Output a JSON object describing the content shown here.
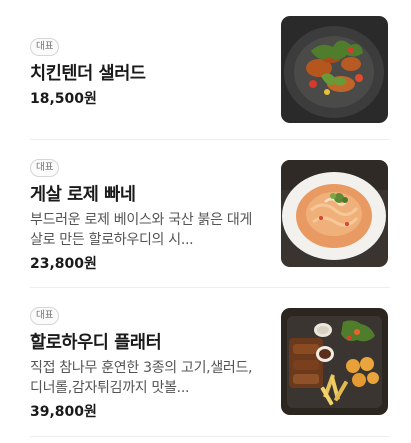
{
  "menu": {
    "items": [
      {
        "badge": "대표",
        "name": "치킨텐더 샐러드",
        "description": "",
        "price": "18,500원",
        "photo_icon": "chicken-tender-salad-photo"
      },
      {
        "badge": "대표",
        "name": "게살 로제 빠네",
        "description": "부드러운 로제 베이스와 국산 붉은 대게살로 만든 할로하우디의 시...",
        "price": "23,800원",
        "photo_icon": "crab-rose-pasta-photo"
      },
      {
        "badge": "대표",
        "name": "할로하우디 플래터",
        "description": "직접 참나무 훈연한 3종의 고기,샐러드,디너롤,감자튀김까지 맛볼...",
        "price": "39,800원",
        "photo_icon": "hallo-howdy-platter-photo"
      }
    ]
  },
  "colors": {
    "name_text": "#1a1a1a",
    "desc_text": "#555555",
    "badge_border": "#d6d6d6",
    "divider": "#eeeeee"
  }
}
